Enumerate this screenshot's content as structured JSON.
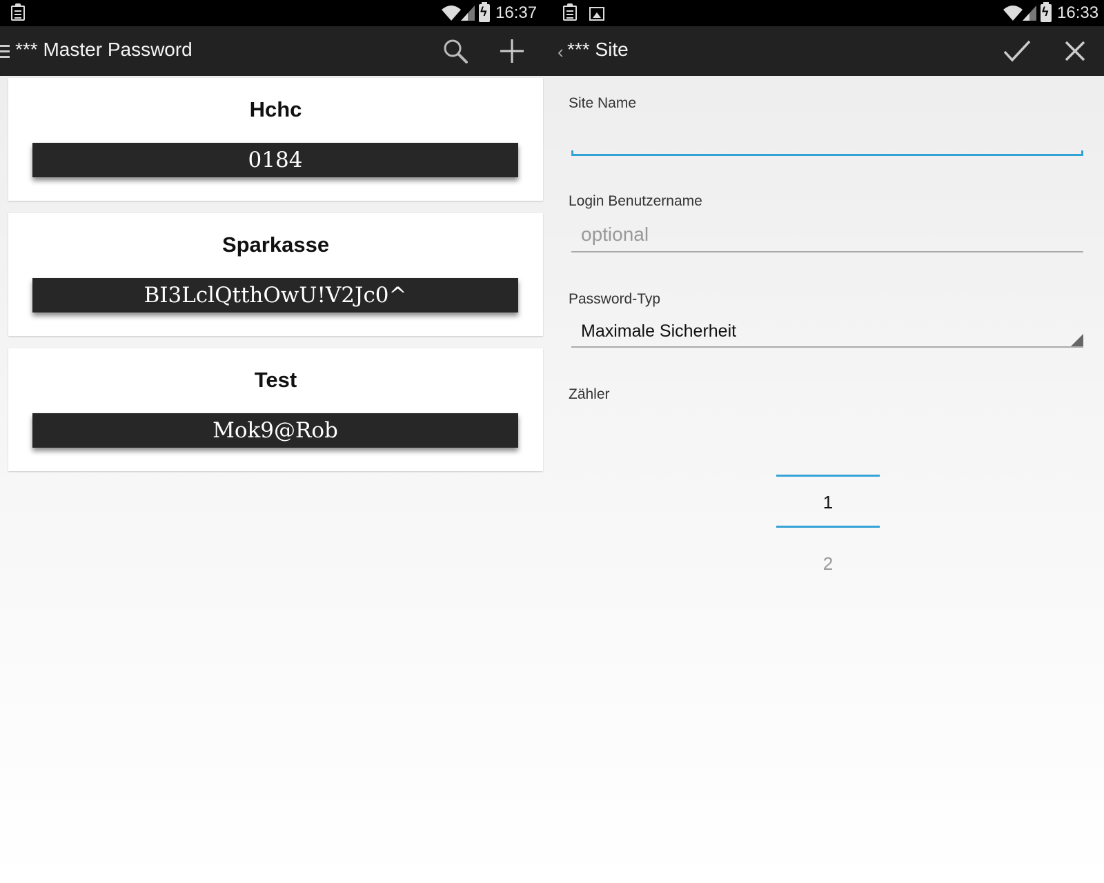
{
  "left_screen": {
    "status_time": "16:37",
    "app_title": "*** Master Password",
    "sites": [
      {
        "name": "Hchc",
        "password": "0184"
      },
      {
        "name": "Sparkasse",
        "password": "BI3LclQtthOwU!V2Jc0^"
      },
      {
        "name": "Test",
        "password": "Mok9@Rob"
      }
    ]
  },
  "right_screen": {
    "status_time": "16:33",
    "title": "*** Site",
    "form": {
      "site_name_label": "Site Name",
      "site_name_value": "",
      "login_label": "Login Benutzername",
      "login_placeholder": "optional",
      "password_type_label": "Password-Typ",
      "password_type_value": "Maximale Sicherheit",
      "counter_label": "Zähler",
      "counter_selected": "1",
      "counter_next": "2"
    }
  },
  "colors": {
    "accent": "#33a3d6",
    "actionbar": "#222222",
    "password_bar": "#272727"
  }
}
